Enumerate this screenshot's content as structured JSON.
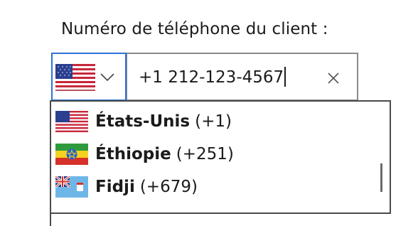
{
  "field": {
    "label": "Numéro de téléphone du client :",
    "value": "+1 212-123-4567",
    "clear_icon": "close-icon"
  },
  "country_select": {
    "selected_flag": "us-flag-icon",
    "dropdown_icon": "chevron-down-icon"
  },
  "dropdown": {
    "items": [
      {
        "name": "États-Unis",
        "code": "(+1)",
        "flag": "us-flag-icon"
      },
      {
        "name": "Éthiopie",
        "code": "(+251)",
        "flag": "ethiopia-flag-icon"
      },
      {
        "name": "Fidji",
        "code": "(+679)",
        "flag": "fiji-flag-icon"
      }
    ]
  },
  "colors": {
    "focus_border": "#2f73d7",
    "field_border": "#8a8a8a",
    "dropdown_border": "#4a4a4a"
  }
}
